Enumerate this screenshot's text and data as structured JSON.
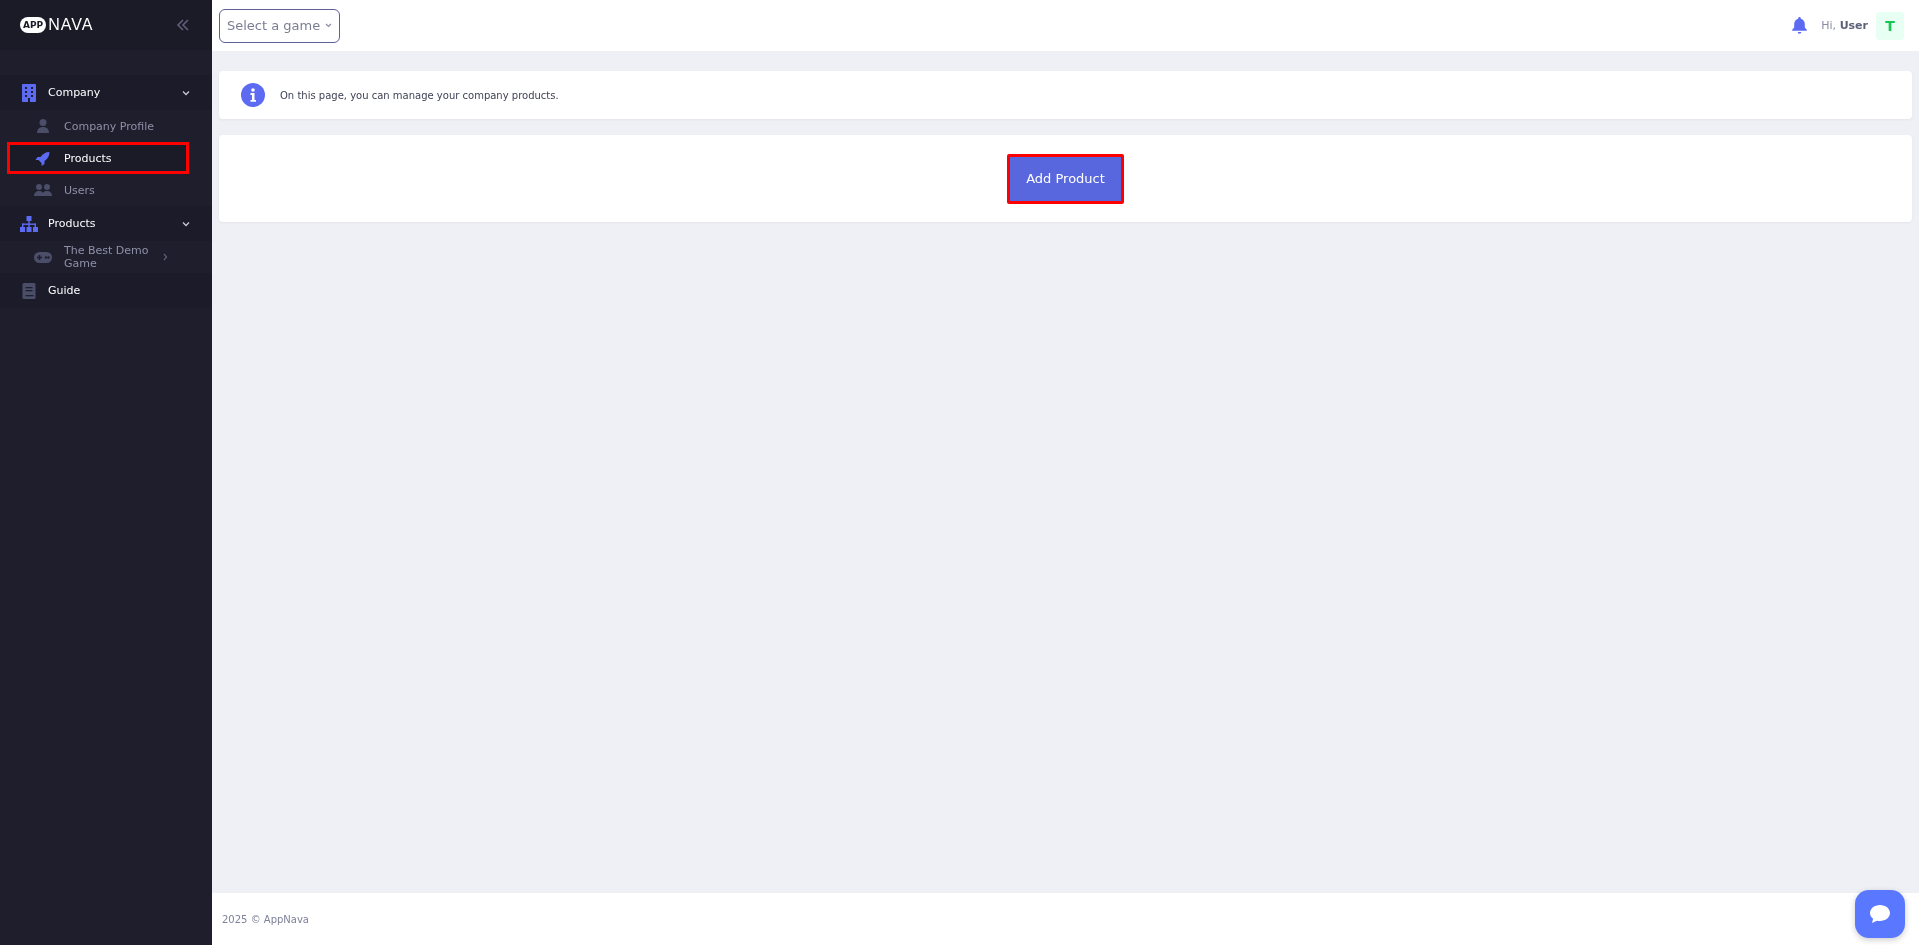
{
  "logo": {
    "badge": "APP",
    "name": "NAVA"
  },
  "sidebar": {
    "items": [
      {
        "label": "Company",
        "expanded": true,
        "children": [
          {
            "label": "Company Profile",
            "selected": false,
            "highlighted": false
          },
          {
            "label": "Products",
            "selected": true,
            "highlighted": true
          },
          {
            "label": "Users",
            "selected": false,
            "highlighted": false
          }
        ]
      },
      {
        "label": "Products",
        "expanded": true,
        "children": [
          {
            "label": "The Best Demo Game",
            "selected": false,
            "highlighted": false,
            "expanded": false
          }
        ]
      },
      {
        "label": "Guide"
      }
    ]
  },
  "header": {
    "game_select": {
      "placeholder": "Select a game"
    },
    "greeting": "Hi, **User**",
    "avatar": "T"
  },
  "info": {
    "text": "On this page, you can manage your company products."
  },
  "actions": {
    "add_button": {
      "label": "Add Product",
      "highlighted": true
    }
  },
  "footer": {
    "text": "2025 © AppNava"
  }
}
